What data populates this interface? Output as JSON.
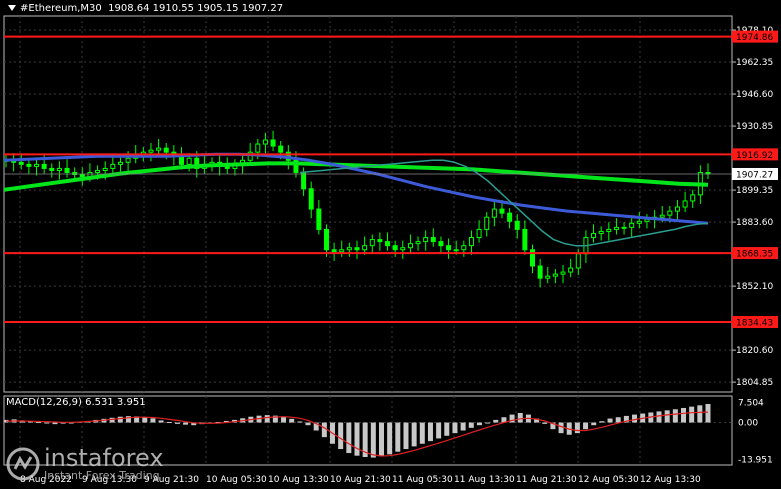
{
  "header": {
    "symbol": "#Ethereum,M30",
    "ohlc": "1908.64 1910.55 1905.15 1907.27"
  },
  "macd_label": "MACD(12,26,9) 6.531 3.951",
  "logo": {
    "name": "instaforex",
    "tagline": "Instant Forex Trading"
  },
  "colors": {
    "background": "#000000",
    "grid": "#3a3a3a",
    "candle": "#00ff00",
    "ma_fast": "#2a9d8f",
    "ma_mid": "#3d5bd9",
    "ma_slow": "#00e61a",
    "level": "#ff1a1a",
    "level_label_bg": "#ff1a1a",
    "price_label_bg": "#ffffff",
    "macd_hist": "#c8c8c8",
    "macd_signal": "#e02020",
    "text": "#ffffff"
  },
  "chart_data": {
    "type": "candlestick",
    "price_axis": {
      "ticks": [
        1978.1,
        1962.35,
        1946.6,
        1930.85,
        1899.35,
        1883.6,
        1852.1,
        1820.6,
        1804.85
      ],
      "ylim": [
        1800,
        1985
      ]
    },
    "horizontal_levels": [
      {
        "label": "1974.86",
        "value": 1974.86
      },
      {
        "label": "1916.92",
        "value": 1916.92
      },
      {
        "label": "1868.35",
        "value": 1868.35
      },
      {
        "label": "1834.43",
        "value": 1834.43
      }
    ],
    "current_price": {
      "label": "1907.27",
      "value": 1907.27
    },
    "x_axis": {
      "labels": [
        "8 Aug 2022",
        "9 Aug 13:30",
        "9 Aug 21:30",
        "10 Aug 05:30",
        "10 Aug 13:30",
        "10 Aug 21:30",
        "11 Aug 05:30",
        "11 Aug 13:30",
        "11 Aug 21:30",
        "12 Aug 05:30",
        "12 Aug 13:30"
      ]
    },
    "series_close": [
      1914,
      1913,
      1912,
      1911,
      1912,
      1910,
      1909,
      1910,
      1908,
      1907,
      1906,
      1908,
      1909,
      1910,
      1912,
      1913,
      1915,
      1917,
      1918,
      1919,
      1920,
      1918,
      1916,
      1912,
      1915,
      1910,
      1912,
      1913,
      1911,
      1910,
      1912,
      1914,
      1918,
      1922,
      1924,
      1921,
      1918,
      1914,
      1908,
      1900,
      1890,
      1880,
      1870,
      1869,
      1870,
      1871,
      1870,
      1872,
      1875,
      1874,
      1872,
      1870,
      1871,
      1873,
      1874,
      1876,
      1874,
      1872,
      1870,
      1870,
      1872,
      1876,
      1880,
      1886,
      1890,
      1888,
      1884,
      1880,
      1870,
      1862,
      1856,
      1857,
      1858,
      1859,
      1861,
      1868,
      1876,
      1878,
      1879,
      1880,
      1881,
      1881,
      1883,
      1884,
      1885,
      1886,
      1887,
      1889,
      1891,
      1894,
      1897,
      1908,
      1907.27
    ],
    "ma_fast": [
      1908,
      1908.5,
      1909,
      1909.5,
      1910,
      1910.5,
      1911,
      1911.5,
      1912,
      1912.5,
      1913,
      1913.5,
      1914,
      1914,
      1913,
      1911,
      1908,
      1904,
      1899,
      1894,
      1889,
      1884,
      1879,
      1875,
      1873,
      1872,
      1872,
      1873,
      1874,
      1875,
      1876,
      1877,
      1878,
      1879,
      1880,
      1881.5,
      1882.5,
      1883
    ],
    "ma_mid": [
      1914,
      1914.5,
      1915,
      1915.5,
      1916,
      1916,
      1916,
      1916,
      1916.5,
      1917,
      1917,
      1916.5,
      1915.5,
      1914,
      1912,
      1909.5,
      1907,
      1904,
      1901,
      1898.5,
      1896,
      1894,
      1892,
      1890.5,
      1889,
      1888,
      1887,
      1886,
      1885,
      1884,
      1883
    ],
    "ma_slow": [
      1899.5,
      1901.5,
      1903.5,
      1905.5,
      1907.5,
      1909,
      1910.5,
      1911.5,
      1912,
      1912.5,
      1912.5,
      1912,
      1911.5,
      1911,
      1910.5,
      1910,
      1909.5,
      1908.5,
      1907.5,
      1906.5,
      1905.5,
      1904.5,
      1903.5,
      1902.5,
      1902
    ],
    "macd": {
      "label": "MACD(12,26,9) 6.531 3.951",
      "ticks": [
        7.504,
        0.0,
        -13.951
      ],
      "tick_labels": [
        "7.504",
        "0.00",
        "-13.951"
      ],
      "histogram": [
        1,
        1.2,
        0.8,
        0.5,
        0.2,
        -0.3,
        -0.6,
        -0.4,
        -0.2,
        0.3,
        0.6,
        1.0,
        1.4,
        1.8,
        2.2,
        2.4,
        2.3,
        2.0,
        1.6,
        0.8,
        0.2,
        -0.5,
        -0.8,
        -1.0,
        -0.6,
        -0.2,
        0.2,
        0.6,
        1.0,
        1.6,
        2.2,
        2.6,
        2.8,
        2.6,
        2.2,
        1.4,
        0.4,
        -1.0,
        -3.0,
        -5.5,
        -8.0,
        -10.0,
        -11.5,
        -12.5,
        -13.0,
        -13.2,
        -12.8,
        -12.0,
        -11.0,
        -10.0,
        -9.0,
        -8.0,
        -7.0,
        -6.0,
        -5.0,
        -4.0,
        -3.0,
        -2.0,
        -1.0,
        0.0,
        1.0,
        2.0,
        3.0,
        3.6,
        3.0,
        1.5,
        -0.5,
        -2.5,
        -4.0,
        -4.6,
        -4.0,
        -2.5,
        -1.0,
        0.5,
        1.5,
        2.0,
        2.5,
        3.0,
        3.4,
        3.8,
        4.2,
        4.6,
        5.0,
        5.5,
        6.0,
        6.5,
        7.0
      ],
      "signal": [
        0.5,
        0.6,
        0.6,
        0.5,
        0.4,
        0.3,
        0.2,
        0.1,
        0.1,
        0.2,
        0.4,
        0.6,
        0.9,
        1.2,
        1.5,
        1.8,
        2.0,
        2.0,
        1.9,
        1.6,
        1.2,
        0.8,
        0.3,
        -0.1,
        -0.3,
        -0.3,
        -0.2,
        0.0,
        0.3,
        0.7,
        1.1,
        1.5,
        1.9,
        2.1,
        2.2,
        2.0,
        1.6,
        0.8,
        -0.4,
        -2.0,
        -4.0,
        -6.0,
        -8.0,
        -9.8,
        -11.2,
        -12.2,
        -12.6,
        -12.5,
        -12.0,
        -11.3,
        -10.5,
        -9.6,
        -8.7,
        -7.8,
        -6.8,
        -5.8,
        -4.8,
        -3.8,
        -2.8,
        -1.8,
        -0.9,
        0.0,
        0.8,
        1.4,
        1.6,
        1.3,
        0.6,
        -0.4,
        -1.5,
        -2.5,
        -3.0,
        -3.0,
        -2.5,
        -1.8,
        -1.0,
        -0.2,
        0.5,
        1.1,
        1.6,
        2.1,
        2.5,
        2.9,
        3.2,
        3.5,
        3.7,
        3.85,
        3.951
      ]
    }
  }
}
